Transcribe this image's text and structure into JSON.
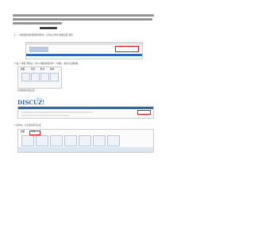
{
  "intro": {
    "lines": 3,
    "note": "BBS 模板"
  },
  "step1": {
    "num": "1.",
    "text": "在界面找到您要装饰的板块，点击右上角的“模板设置”按钮"
  },
  "step2": {
    "text": "2.进入“模板”面板后，您可以根据需要选择一个模板，或自行设置模板"
  },
  "tabs": [
    "模板",
    "布局",
    "样式",
    "模块"
  ],
  "caption1": "在线编辑/模板设置",
  "logo": {
    "name": "DISCUZ!",
    "sub": "Discuz!"
  },
  "step3": {
    "text": "3.选中后，点击保存即可完成",
    "highlight": "点击保存"
  },
  "footer_tabs": [
    "模板",
    "布局"
  ]
}
